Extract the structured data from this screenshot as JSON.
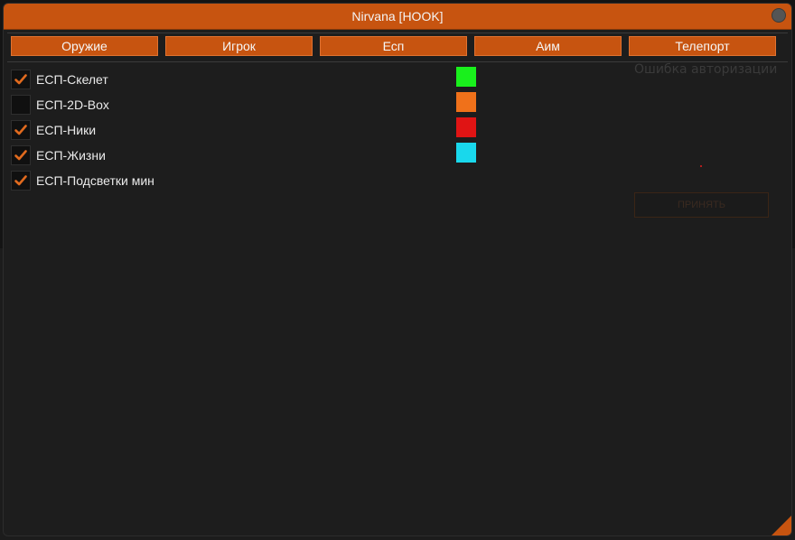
{
  "window": {
    "title": "Nirvana [HOOK]"
  },
  "tabs": [
    {
      "label": "Оружие"
    },
    {
      "label": "Игрок"
    },
    {
      "label": "Есп"
    },
    {
      "label": "Аим"
    },
    {
      "label": "Телепорт"
    }
  ],
  "esp_options": [
    {
      "label": "ЕСП-Скелет",
      "checked": true,
      "color": "#19f01c"
    },
    {
      "label": "ЕСП-2D-Box",
      "checked": false,
      "color": "#f0711a"
    },
    {
      "label": "ЕСП-Ники",
      "checked": true,
      "color": "#e01414"
    },
    {
      "label": "ЕСП-Жизни",
      "checked": true,
      "color": "#19d8ec"
    },
    {
      "label": "ЕСП-Подсветки мин",
      "checked": true
    }
  ],
  "auth": {
    "error_text": "Ошибка авторизации",
    "accept_label": "ПРИНЯТЬ"
  },
  "colors": {
    "accent": "#c75410",
    "window_bg": "#1d1d1d",
    "check": "#e06a1e"
  },
  "icons": [
    "close-icon",
    "check-icon",
    "resize-grip-icon"
  ]
}
